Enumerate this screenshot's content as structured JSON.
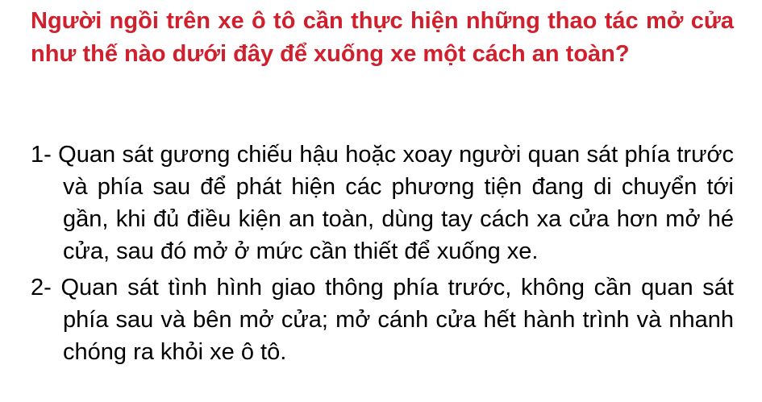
{
  "theme": {
    "question_color": "#d0202e",
    "text_color": "#000000"
  },
  "question": {
    "text": "Người ngồi trên xe ô tô cần thực hiện những thao tác mở cửa như thế nào dưới đây để xuống xe một cách an toàn?"
  },
  "options": [
    {
      "text": "1- Quan sát gương chiếu hậu hoặc xoay người quan sát phía trước và phía sau để phát hiện các phương tiện đang di chuyển tới gần, khi đủ điều kiện an toàn, dùng tay cách xa cửa hơn mở hé cửa, sau đó mở ở mức cần thiết để xuống xe."
    },
    {
      "text": "2- Quan sát tình hình giao thông phía trước, không cần quan sát phía sau và bên mở cửa; mở cánh cửa hết hành trình và nhanh chóng ra khỏi xe ô tô."
    }
  ]
}
